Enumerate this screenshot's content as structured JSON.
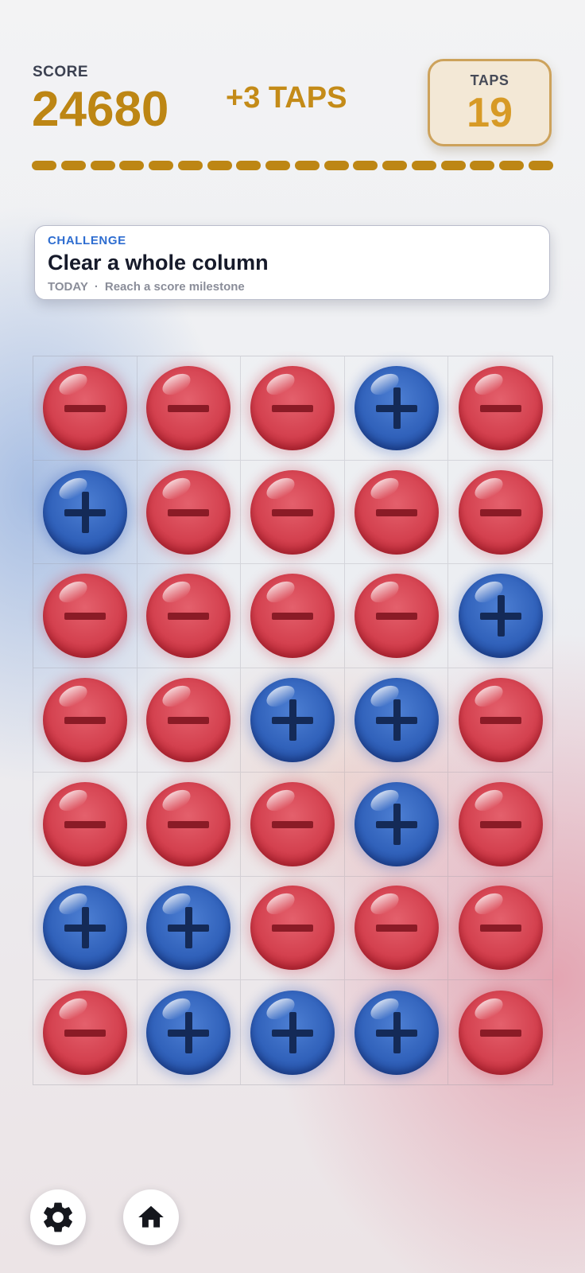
{
  "header": {
    "score_label": "SCORE",
    "score_value": "24680",
    "bonus_text": "+3 TAPS",
    "taps_label": "TAPS",
    "taps_value": "19",
    "progress_segments": 18,
    "accent_color": "#bd8614"
  },
  "challenge": {
    "tag": "CHALLENGE",
    "title": "Clear a whole column",
    "period": "TODAY",
    "separator": "·",
    "description": "Reach a score milestone"
  },
  "board": {
    "columns": 5,
    "rows": 7,
    "cells": [
      [
        "minus",
        "minus",
        "minus",
        "plus",
        "minus"
      ],
      [
        "plus",
        "minus",
        "minus",
        "minus",
        "minus"
      ],
      [
        "minus",
        "minus",
        "minus",
        "minus",
        "plus"
      ],
      [
        "minus",
        "minus",
        "plus",
        "plus",
        "minus"
      ],
      [
        "minus",
        "minus",
        "minus",
        "plus",
        "minus"
      ],
      [
        "plus",
        "plus",
        "minus",
        "minus",
        "minus"
      ],
      [
        "minus",
        "plus",
        "plus",
        "plus",
        "minus"
      ]
    ],
    "colors": {
      "minus": "#d4414f",
      "plus": "#3162bb"
    }
  },
  "footer": {
    "buttons": [
      {
        "name": "settings-button",
        "icon": "gear-icon"
      },
      {
        "name": "home-button",
        "icon": "home-icon"
      }
    ]
  }
}
